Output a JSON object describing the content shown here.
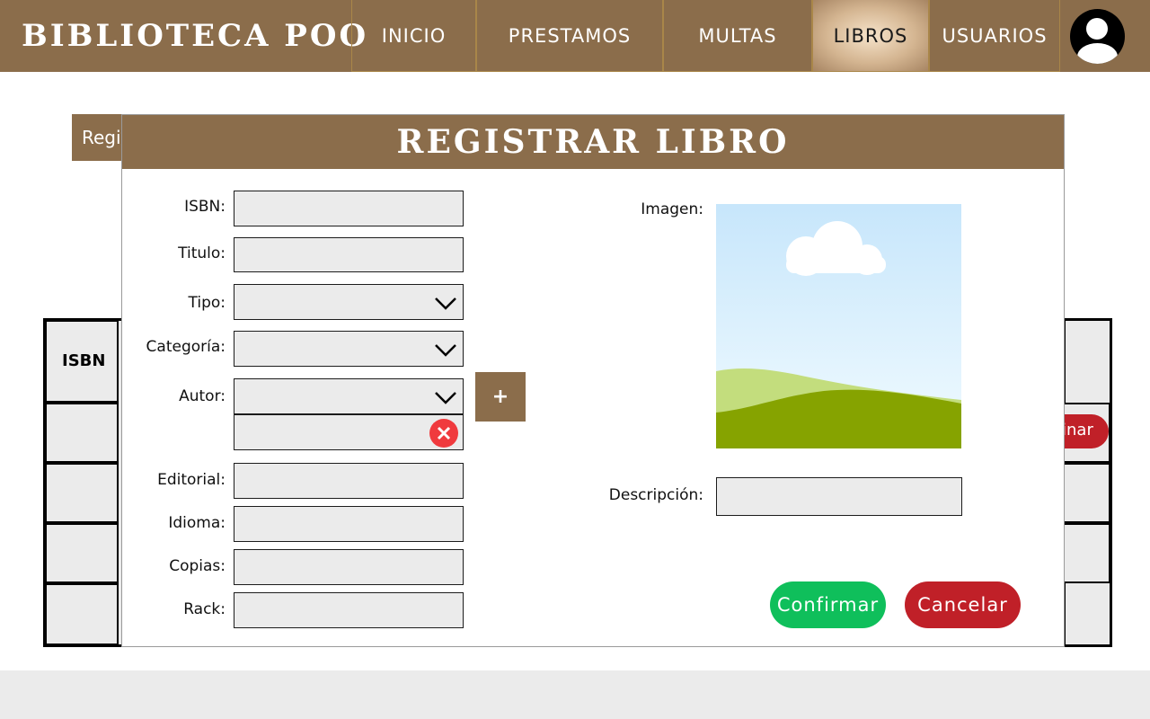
{
  "navbar": {
    "brand": "BIBLIOTECA POO",
    "items": [
      {
        "label": "INICIO"
      },
      {
        "label": "PRESTAMOS"
      },
      {
        "label": "MULTAS"
      },
      {
        "label": "LIBROS"
      },
      {
        "label": "USUARIOS"
      }
    ],
    "active": "LIBROS"
  },
  "background": {
    "register_bar_label": "Regi",
    "table_header_isbn": "ISBN",
    "row_action_label": "inar"
  },
  "modal": {
    "title": "REGISTRAR LIBRO",
    "fields": {
      "isbn": {
        "label": "ISBN:",
        "value": ""
      },
      "titulo": {
        "label": "Titulo:",
        "value": ""
      },
      "tipo": {
        "label": "Tipo:",
        "value": ""
      },
      "categoria": {
        "label": "Categoría:",
        "value": ""
      },
      "autor": {
        "label": "Autor:",
        "value": ""
      },
      "autor_extra": {
        "value": ""
      },
      "editorial": {
        "label": "Editorial:",
        "value": ""
      },
      "idioma": {
        "label": "Idioma:",
        "value": ""
      },
      "copias": {
        "label": "Copias:",
        "value": ""
      },
      "rack": {
        "label": "Rack:",
        "value": ""
      },
      "imagen": {
        "label": "Imagen:"
      },
      "descripcion": {
        "label": "Descripción:",
        "value": ""
      }
    },
    "add_author_button": "+",
    "confirm_button": "Confirmar",
    "cancel_button": "Cancelar"
  },
  "colors": {
    "brand_brown": "#8b6d4b",
    "confirm_green": "#0fbf5b",
    "cancel_red": "#c02028",
    "remove_red": "#f03a3e",
    "field_gray": "#ebebeb"
  },
  "icons": [
    "user-avatar-icon",
    "chevron-down-icon",
    "plus-icon",
    "close-circle-icon",
    "image-placeholder-icon"
  ]
}
